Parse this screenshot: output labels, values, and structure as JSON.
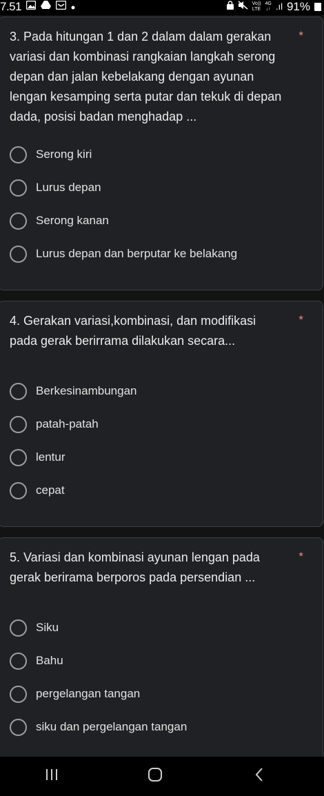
{
  "status_bar": {
    "time": "7.51",
    "left_icons": [
      "gallery-icon",
      "drive-icon",
      "inbox-icon",
      "dot-icon"
    ],
    "right_icons": [
      "lock-icon",
      "mute-icon"
    ],
    "volte_top": "Vo))",
    "volte_bottom": "LTE",
    "network_top": "4G",
    "network_bottom": "↓↑",
    "signal": ".ıl",
    "battery": "91%"
  },
  "questions": [
    {
      "text": "3. Pada hitungan 1 dan 2 dalam dalam gerakan variasi dan kombinasi rangkaian langkah serong depan dan jalan kebelakang dengan ayunan lengan kesamping serta putar dan tekuk di depan dada, posisi badan menghadap ...",
      "required_mark": "*",
      "options": [
        "Serong kiri",
        "Lurus depan",
        "Serong kanan",
        "Lurus depan dan berputar ke belakang"
      ]
    },
    {
      "text": "4. Gerakan variasi,kombinasi, dan modifikasi pada gerak berirrama dilakukan secara...",
      "required_mark": "*",
      "options": [
        "Berkesinambungan",
        "patah-patah",
        "lentur",
        "cepat"
      ]
    },
    {
      "text": "5. Variasi dan kombinasi ayunan lengan pada gerak berirama berporos pada persendian ...",
      "required_mark": "*",
      "options": [
        "Siku",
        "Bahu",
        "pergelangan tangan",
        "siku dan pergelangan tangan"
      ]
    }
  ],
  "nav_bar": {
    "buttons": [
      "recent-apps-icon",
      "home-icon",
      "back-icon"
    ]
  }
}
